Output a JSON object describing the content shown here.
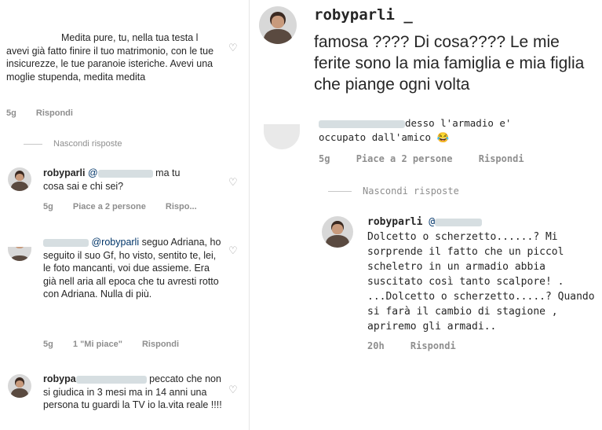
{
  "left": {
    "c1": {
      "text": "Medita pure, tu, nella tua testa l avevi già fatto finire il tuo matrimonio, con le tue insicurezze, le tue paranoie isteriche. Avevi una moglie stupenda, medita medita",
      "time": "5g",
      "reply": "Rispondi"
    },
    "hide_replies": "Nascondi risposte",
    "c2": {
      "username": "robyparli",
      "mention": "@",
      "text_a": "ma tu",
      "text_b": "cosa sai e chi sei?",
      "time": "5g",
      "likes": "Piace a 2 persone",
      "reply": "Rispo..."
    },
    "c3": {
      "mention": "@robyparli",
      "text_a": "seguo",
      "text_b": "Adriana, ho seguito il suo Gf, ho visto, sentito te, lei, le foto mancanti, voi due assieme. Era già nell aria all epoca che tu avresti rotto con Adriana. Nulla di più.",
      "time": "5g",
      "likes": "1 \"Mi piace\"",
      "reply": "Rispondi"
    },
    "c4": {
      "username": "robypa",
      "text_a": "peccato",
      "text_b": "che non si giudica in 3 mesi ma in 14 anni una persona tu guardi la TV io la.vita reale !!!!"
    }
  },
  "right": {
    "c1": {
      "username": "robyparli _",
      "text": "famosa ???? Di cosa???? Le mie ferite sono la mia famiglia e mia figlia che piange ogni volta"
    },
    "c2": {
      "text_a": "desso l'armadio e'",
      "text_b": "occupato dall'amico 😂",
      "time": "5g",
      "likes": "Piace a 2 persone",
      "reply": "Rispondi"
    },
    "hide_replies": "Nascondi risposte",
    "c3": {
      "username": "robyparli",
      "mention": "@",
      "text": "Dolcetto o scherzetto......? Mi sorprende il fatto che un piccol scheletro in un armadio abbia suscitato così tanto scalpore! . ...Dolcetto o scherzetto.....? Quando si farà il cambio di stagione , apriremo gli armadi..",
      "time": "20h",
      "reply": "Rispondi"
    }
  },
  "icons": {
    "heart": "heart-outline-icon"
  },
  "colors": {
    "text": "#262626",
    "meta": "#8e8e8e",
    "bg": "#ffffff"
  }
}
